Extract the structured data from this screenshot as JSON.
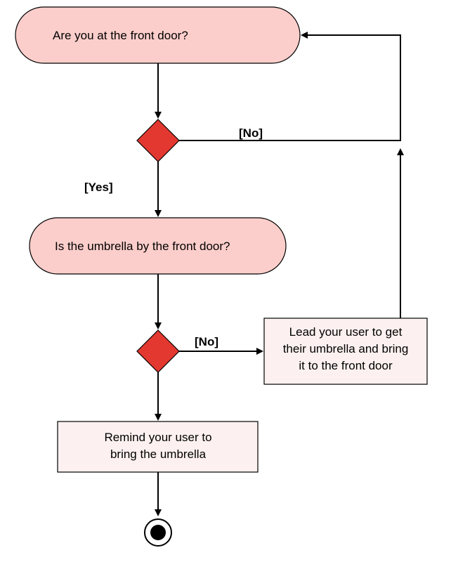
{
  "nodes": {
    "q1": "Are you at the front door?",
    "q2": "Is the umbrella by the front door?",
    "action_remind_l1": "Remind your user to",
    "action_remind_l2": "bring the umbrella",
    "action_lead_l1": "Lead your user to get",
    "action_lead_l2": "their umbrella and bring",
    "action_lead_l3": "it to the front door"
  },
  "edges": {
    "yes": "[Yes]",
    "no1": "[No]",
    "no2": "[No]"
  }
}
